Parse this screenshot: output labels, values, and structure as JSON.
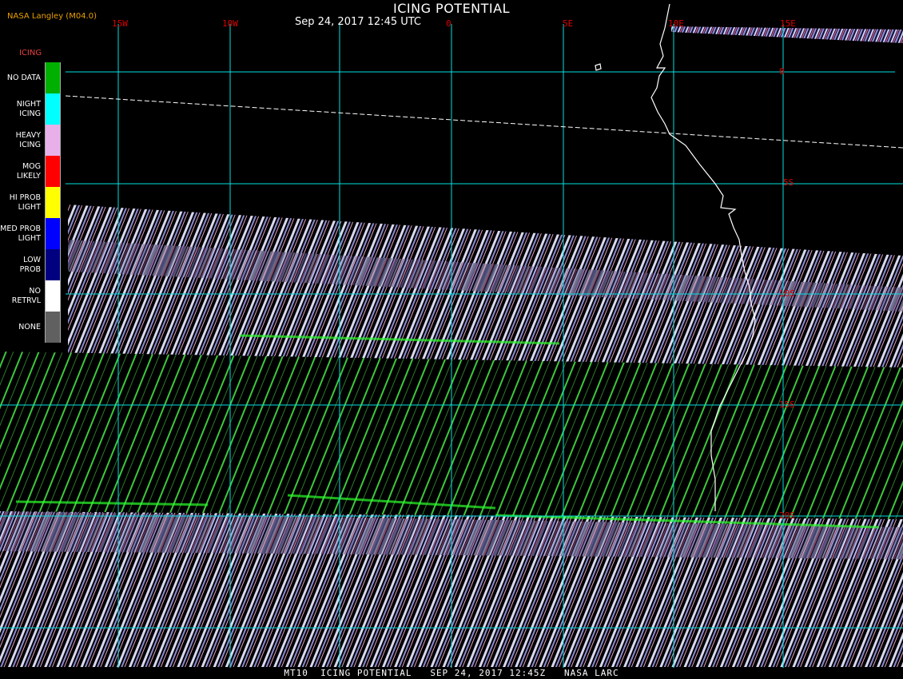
{
  "header": {
    "title": "ICING POTENTIAL",
    "subtitle": "Sep 24, 2017 12:45 UTC",
    "producer": "NASA Langley (M04.0)"
  },
  "map": {
    "longitude_labels": [
      "15W",
      "10W",
      "0",
      "5E",
      "10E",
      "15E"
    ],
    "latitude_labels": [
      "0",
      "5S",
      "10S",
      "15S",
      "20S"
    ],
    "colors": {
      "grid": "#00e0e0",
      "labels": "#dd0000",
      "coastline": "#ffffff"
    }
  },
  "legend": {
    "title": "ICING",
    "items": [
      {
        "label": "NO DATA",
        "color": "#00b000"
      },
      {
        "label": "NIGHT\nICING",
        "color": "#00ffff"
      },
      {
        "label": "HEAVY\nICING",
        "color": "#e8b0e8"
      },
      {
        "label": "MOG\nLIKELY",
        "color": "#ff0000"
      },
      {
        "label": "HI PROB\nLIGHT",
        "color": "#ffff00"
      },
      {
        "label": "MED PROB\nLIGHT",
        "color": "#0000ff"
      },
      {
        "label": "LOW\nPROB",
        "color": "#000080"
      },
      {
        "label": "NO\nRETRVL",
        "color": "#ffffff"
      },
      {
        "label": "NONE",
        "color": "#606060"
      }
    ]
  },
  "footer": {
    "caption": "MT10  ICING POTENTIAL   SEP 24, 2017 12:45Z   NASA LARC"
  }
}
